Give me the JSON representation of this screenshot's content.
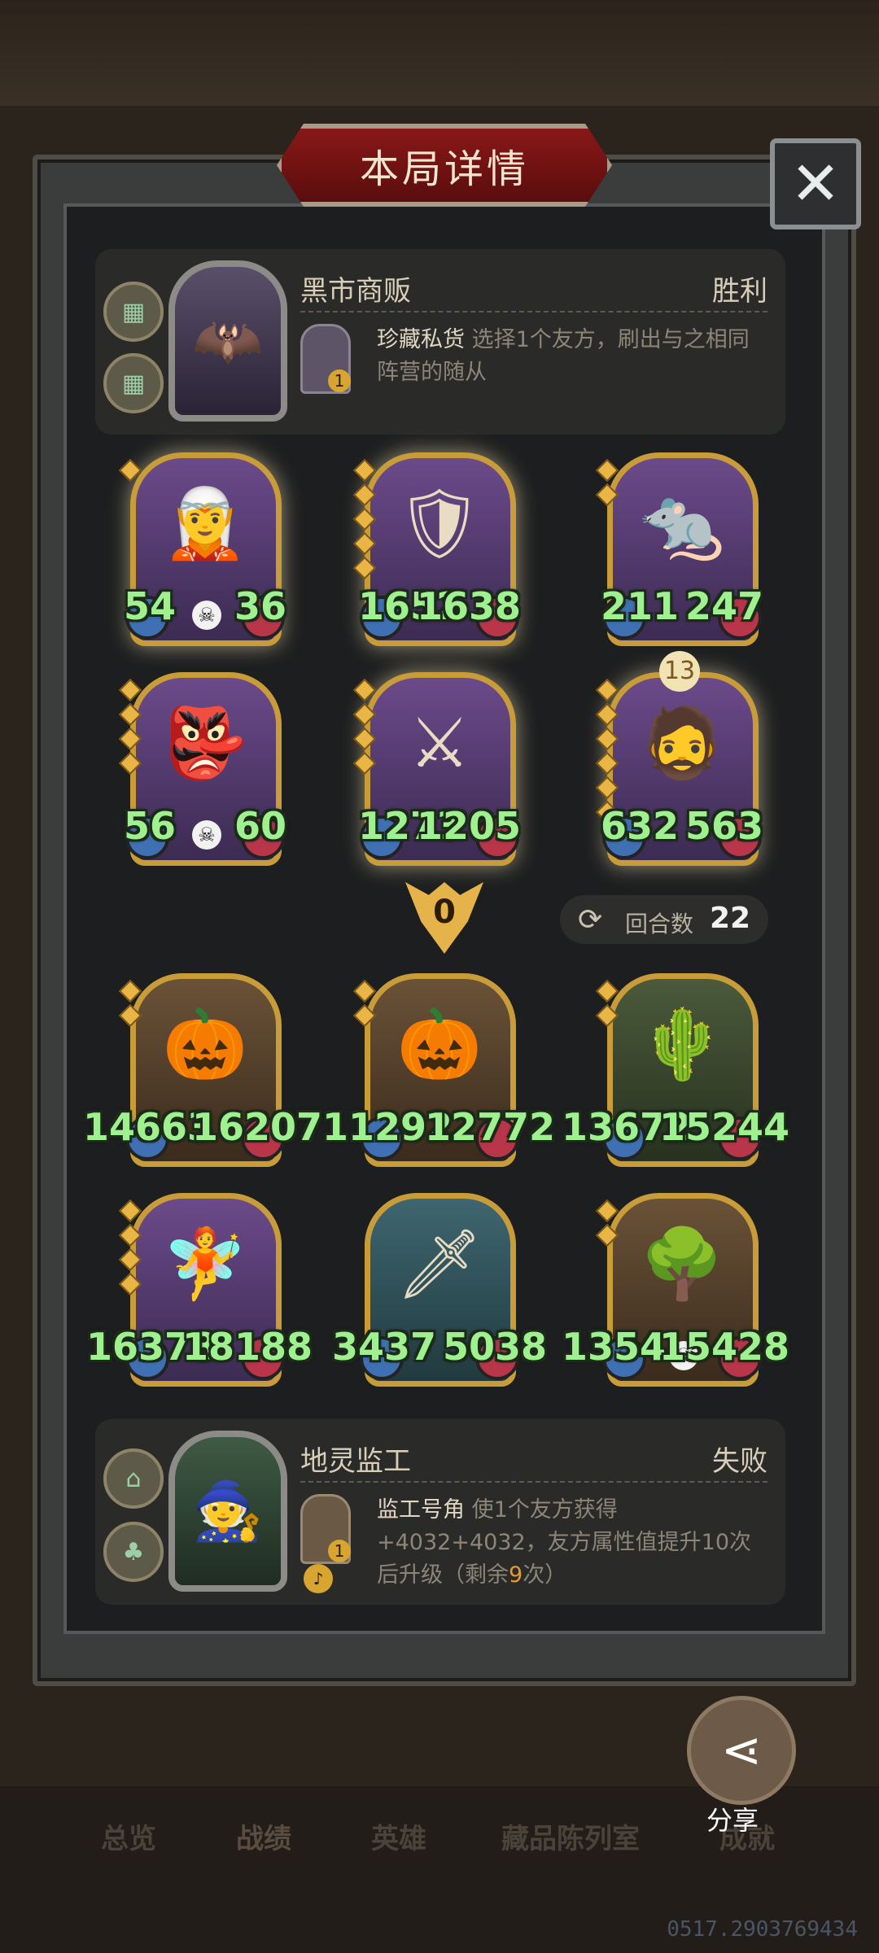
{
  "title": "本局详情",
  "close_icon": "close-icon",
  "top_player": {
    "name": "黑市商贩",
    "result": "胜利",
    "skill_name": "珍藏私货",
    "skill_desc": "选择1个友方，刷出与之相同阵营的随从",
    "skill_badge": "1"
  },
  "top_units": [
    {
      "atk": "54",
      "hp": "36"
    },
    {
      "atk": "1652",
      "hp": "1638"
    },
    {
      "atk": "211",
      "hp": "247"
    },
    {
      "atk": "56",
      "hp": "60"
    },
    {
      "atk": "1273",
      "hp": "1205"
    },
    {
      "atk": "632",
      "hp": "563",
      "level": "13"
    }
  ],
  "shield_value": "0",
  "rounds": {
    "label": "回合数",
    "value": "22"
  },
  "bottom_units": [
    {
      "atk": "14663",
      "hp": "16207"
    },
    {
      "atk": "11292",
      "hp": "12772"
    },
    {
      "atk": "13672",
      "hp": "15244"
    },
    {
      "atk": "16378",
      "hp": "18188"
    },
    {
      "atk": "3437",
      "hp": "5038"
    },
    {
      "atk": "1354",
      "hp": "15428"
    }
  ],
  "bottom_player": {
    "name": "地灵监工",
    "result": "失败",
    "skill_name": "监工号角",
    "skill_desc_1": "使1个友方获得+4032+4032，友方属性值提升10次后升级（剩余",
    "skill_remaining": "9",
    "skill_desc_2": "次）",
    "skill_badge": "1"
  },
  "share_label": "分享",
  "tabs": [
    "总览",
    "战绩",
    "英雄",
    "藏品陈列室",
    "成就"
  ],
  "watermark": "0517.2903769434"
}
